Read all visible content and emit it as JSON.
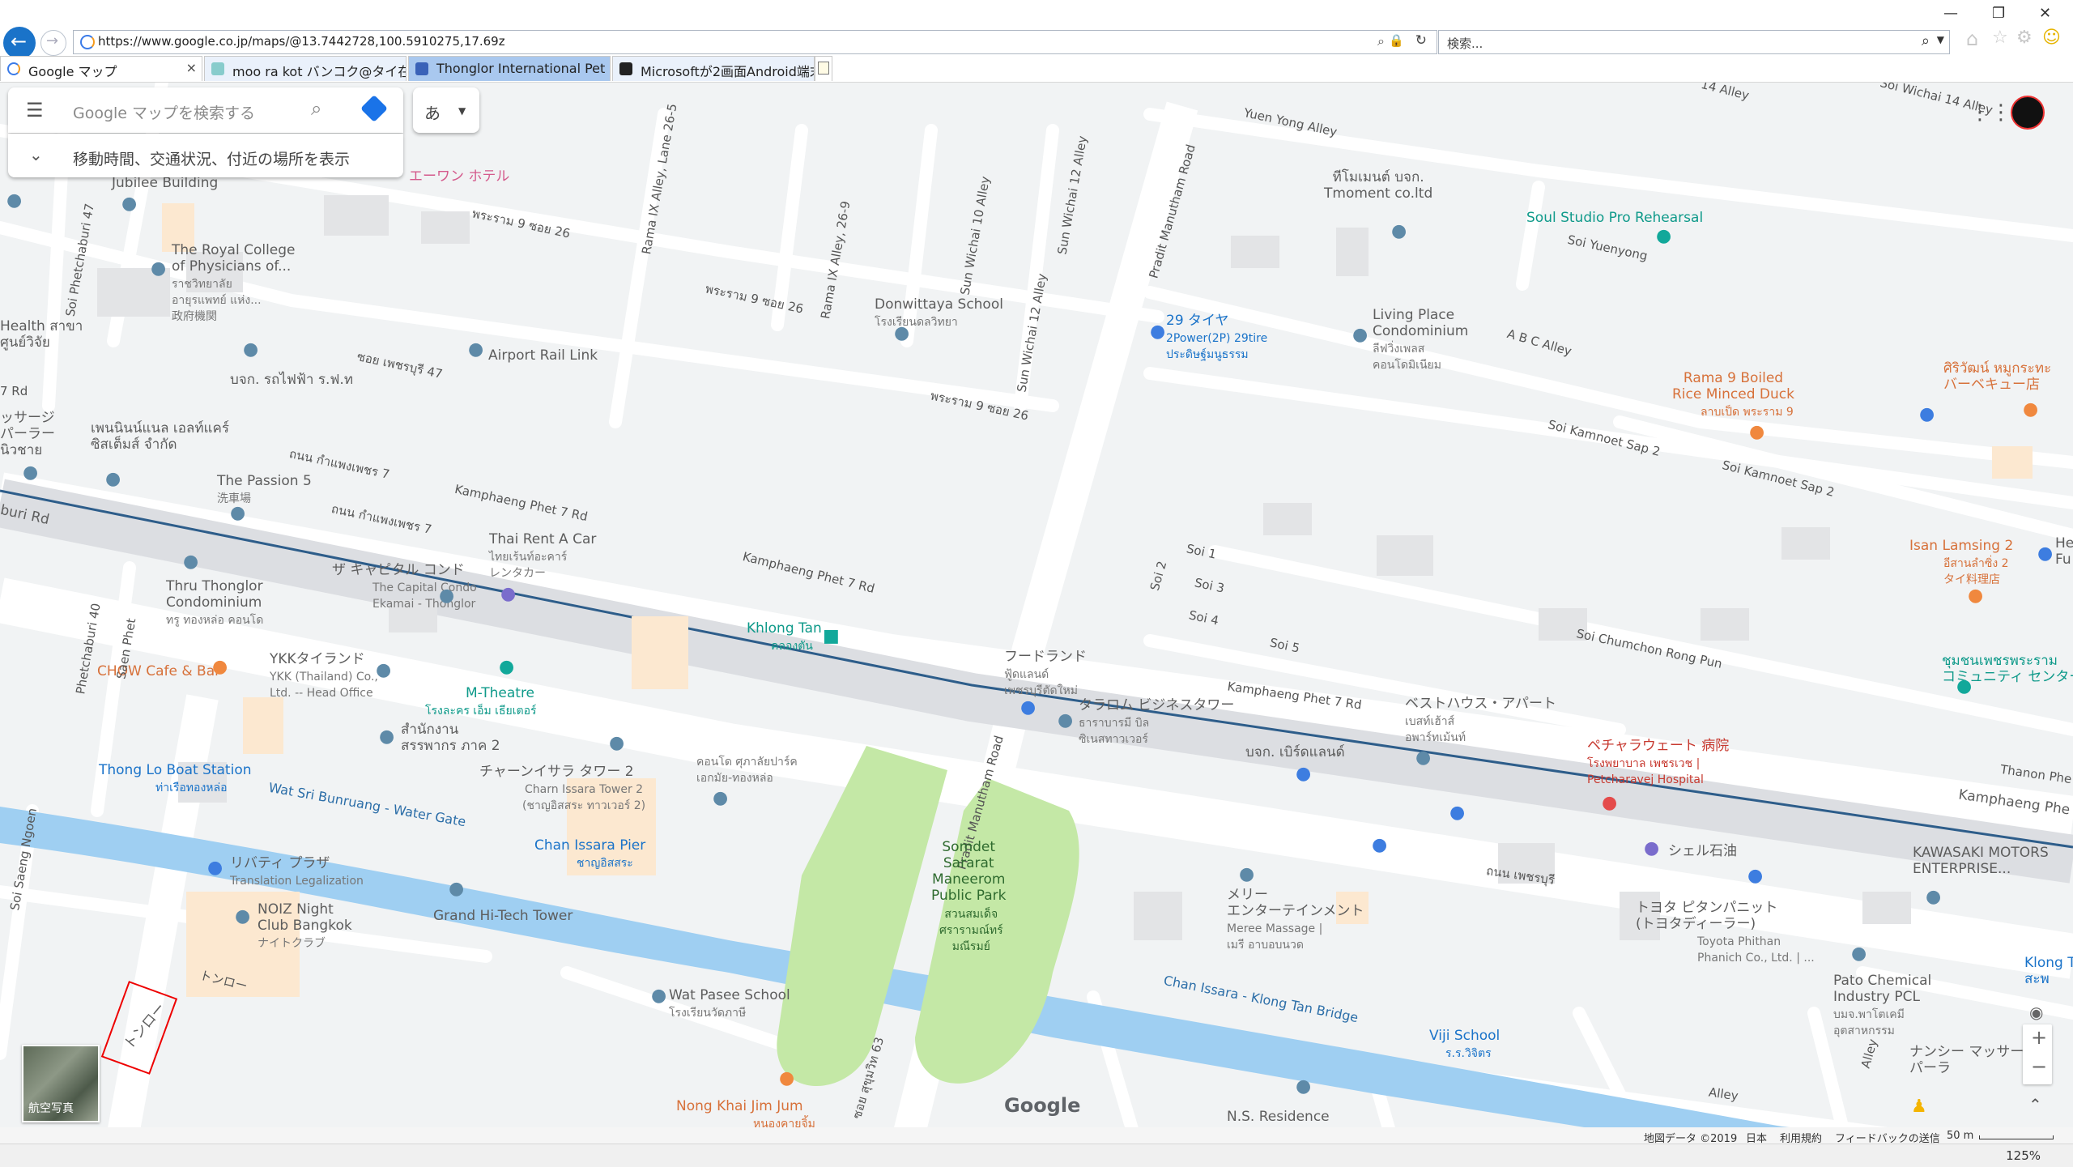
{
  "browser": {
    "url": "https://www.google.co.jp/maps/@13.7442728,100.5910275,17.69z",
    "search_placeholder": "検索...",
    "tabs": [
      {
        "label": "Google マップ",
        "active": true
      },
      {
        "label": "moo ra kot バンコク@タイ在住／..."
      },
      {
        "label": "Thonglor International Pet Hos..."
      },
      {
        "label": "Microsoftが2画面Android端末..."
      }
    ],
    "zoom": "125%"
  },
  "maps_ui": {
    "search_placeholder": "Google マップを検索する",
    "subbar_text": "移動時間、交通状況、付近の場所を表示",
    "lang_button": "あ",
    "aerial_label": "航空写真",
    "zoom_in": "+",
    "zoom_out": "−",
    "google_logo": "Google",
    "footer": {
      "map_data": "地図データ ©2019",
      "region": "日本",
      "terms": "利用規約",
      "feedback": "フィードバックの送信",
      "scale": "50 m"
    }
  },
  "map_labels": {
    "jubilee": "Jubilee Building",
    "royal_college": "The Royal College\nof Physicians of...",
    "royal_college_th": "ราชวิทยาลัย\nอายุรแพทย์ แห่ง...\n政府機関",
    "rama9_26a": "พระราม 9 ซอย 26",
    "rama9_26b": "พระราม 9 ซอย 26",
    "rama9_26c": "พระราม 9 ซอย 26",
    "health": "Health สาขา\nศูนย์วิจัย",
    "airport_rail": "Airport Rail Link",
    "rail_th": "บจก. รถไฟฟ้า ร.ฟ.ท",
    "soi_phet47": "ซอย เพชรบุรี 47",
    "donwittaya": "Donwittaya School",
    "donwittaya_th": "โรงเรียนดลวิทยา",
    "tmoment": "ทีโมเมนต์ บจก.\nTmoment co.ltd",
    "soul_studio": "Soul Studio Pro Rehearsal",
    "pradit_road": "Pradit Manutham Road",
    "yuen_yong": "Yuen Yong Alley",
    "soi_yuenyong": "Soi Yuenyong",
    "tire29": "29 タイヤ",
    "tire29_en": "2Power(2P) 29tire",
    "tire29_th": "ประดิษฐ์มนูธรรม",
    "living_place": "Living Place\nCondominium",
    "living_place_th": "ลีฟวิ่งเพลส\nคอนโดมิเนียม",
    "abc_alley": "A B C Alley",
    "rama9_boiled": "Rama 9 Boiled\nRice Minced Duck",
    "rama9_boiled_th": "ลาบเป็ด พระราม 9",
    "siriwat": "ศิริวัฒน์ หมูกระทะ\nバーベキュー店",
    "kamnoet2": "Soi Kamnoet Sap 2",
    "kamnoet2b": "Soi Kamnoet Sap 2",
    "massage": "ッサージ\nパーラー\nนิวชาย",
    "phinnan": "เพนนินน์แนล เอลท์แคร์\nซิสเต็มส์ จำกัด",
    "passion5": "The Passion 5",
    "passion5_th": "洗車場",
    "kamphaeng_th": "ถนน กำแพงเพชร 7",
    "kamphaeng_th2": "ถนน กำแพงเพชร 7",
    "kamphaeng7": "Kamphaeng Phet 7 Rd",
    "kamphaeng7b": "Kamphaeng Phet 7 Rd",
    "kamphaeng7c": "Kamphaeng Phet 7 Rd",
    "thai_rent": "Thai Rent A Car",
    "thai_rent_th": "ไทยเร้นท์อะคาร์\nレンタカー",
    "buri_rd": "buri Rd",
    "thru_thonglor": "Thru Thonglor\nCondominium",
    "thru_thonglor_th": "ทรู ทองหล่อ คอนโด",
    "capital": "ザ キャピタル コンド",
    "capital_en": "The Capital Condo\nEkamai - Thonglor",
    "khlong_tan": "Khlong Tan",
    "khlong_tan_th": "คลองตัน",
    "ykk": "YKKタイランド",
    "ykk_en": "YKK (Thailand) Co.,\nLtd. -- Head Office",
    "chow": "CHOW Cafe & Bar",
    "m_theatre": "M-Theatre",
    "m_theatre_th": "โรงละคร เอ็ม เธียเตอร์",
    "sorpor": "สำนักงาน\nสรรพากร ภาค 2",
    "chan_issara2": "チャーンイサラ タワー 2",
    "chan_issara2_en": "Charn Issara Tower 2\n(ชาญอิสสระ ทาวเวอร์ 2)",
    "condo_ekkamai": "คอนโด ศุภาลัยปาร์ค\nเอกมัย-ทองหล่อ",
    "thonglo_boat": "Thong Lo Boat Station",
    "thonglo_boat_th": "ท่าเรือทองหล่อ",
    "wat_sri": "Wat Sri Bunruang - Water Gate",
    "chan_pier": "Chan Issara Pier",
    "chan_pier_th": "ชาญอิสสระ",
    "liberty": "リバティ プラザ",
    "liberty_en": "Translation Legalization",
    "noiz": "NOIZ Night\nClub Bangkok",
    "noiz_jp": "ナイトクラブ",
    "grand_hitech": "Grand Hi-Tech Tower",
    "thonglor_road": "トンロー",
    "thonglor_box": "トンロー",
    "wat_pasee": "Wat Pasee School",
    "wat_pasee_th": "โรงเรียนวัดภาษี",
    "nongkhai": "Nong Khai Jim Jum",
    "nongkhai_th": "หนองคายจิ้ม\nจุ่มทองหล่อ",
    "sukhumvit63": "ซอย สุขุมวิท 63",
    "pradit_road2": "Pradit Manutham Road",
    "somdet": "Somdet\nSararat\nManeerom\nPublic Park",
    "somdet_th": "สวนสมเด็จ\nศรารามณ์ทร์\nมณีรมย์",
    "foodland": "フードランド",
    "foodland_th": "ฟู้ดแลนด์\nเพชรบุรีตัดใหม่",
    "taralom": "タラロム ビジネスタワー",
    "taralom_th": "ธาราบารมี บิล\nซิเนสทาวเวอร์",
    "best_house": "ベストハウス・アパート",
    "best_house_th": "เบสท์เฮ้าส์\nอพาร์ทเม้นท์",
    "brilliant": "บจก. เบิร์ดแลนด์",
    "phyathai": "ペチャラウェート 病院",
    "phyathai_th": "โรงพยาบาล เพชรเวช |\nPetcharavej Hospital",
    "shell": "シェル石油",
    "kawasaki": "KAWASAKI MOTORS\nENTERPRISE...",
    "meree": "メリー\nエンターテインメント",
    "meree_en": "Meree Massage |\nเมรี อาบอบนวด",
    "toyota": "トヨタ ピタンパニット\n(トヨタディーラー)",
    "toyota_en": "Toyota Phithan\nPhanich Co., Ltd. | ...",
    "pato": "Pato Chemical\nIndustry PCL",
    "pato_th": "บมจ.พาโตเคมี\nอุตสาหกรรม",
    "chan_bridge": "Chan Issara - Klong Tan Bridge",
    "viji": "Viji School",
    "viji_th": "ร.ร.วิจิตร",
    "ns_residence": "N.S. Residence",
    "nancy": "ナンシー マッサー\nパーラ",
    "klong_t": "Klong T\nสะพ",
    "isan": "Isan Lamsing 2",
    "isan_th": "อีสานลำซิ่ง 2\nタイ料理店",
    "chumchon": "ชุมชนเพชรพระราม\nコミュニティ センター",
    "soi_chumchon": "Soi Chumchon Rong Pun",
    "kamphaeng_r": "Kamphaeng Phe",
    "thanon_phet": "Thanon Phe",
    "phetchaburi_th": "ถนน เพชรบุรี",
    "soi1": "Soi 1",
    "soi2": "Soi 2",
    "soi3": "Soi 3",
    "soi4": "Soi 4",
    "soi5": "Soi 5",
    "soi_wichai10": "Sun Wichai 10 Alley",
    "soi_wichai12": "Sun Wichai 12 Alley",
    "soi_wichai12b": "Sun Wichai 12 Alley",
    "rama9_26_9": "Rama IX Alley, 26-9",
    "rama9_26_5": "Rama IX Alley, Lane 26-5",
    "soi_sang": "Soi Saeng Ngoen",
    "soi_phet40": "Phetchaburi 40",
    "soi_saen": "Saen Phet",
    "soi_phetburi47": "Soi Phetchaburi 47",
    "alley": "Alley",
    "alley2": "Alley",
    "hefu": "He\nFu",
    "soi_wichai14": "Soi Wichai 14 Alley",
    "soi_14": "14 Alley",
    "rd_7": "7 Rd",
    "hotel": "エーワン ホテル"
  }
}
